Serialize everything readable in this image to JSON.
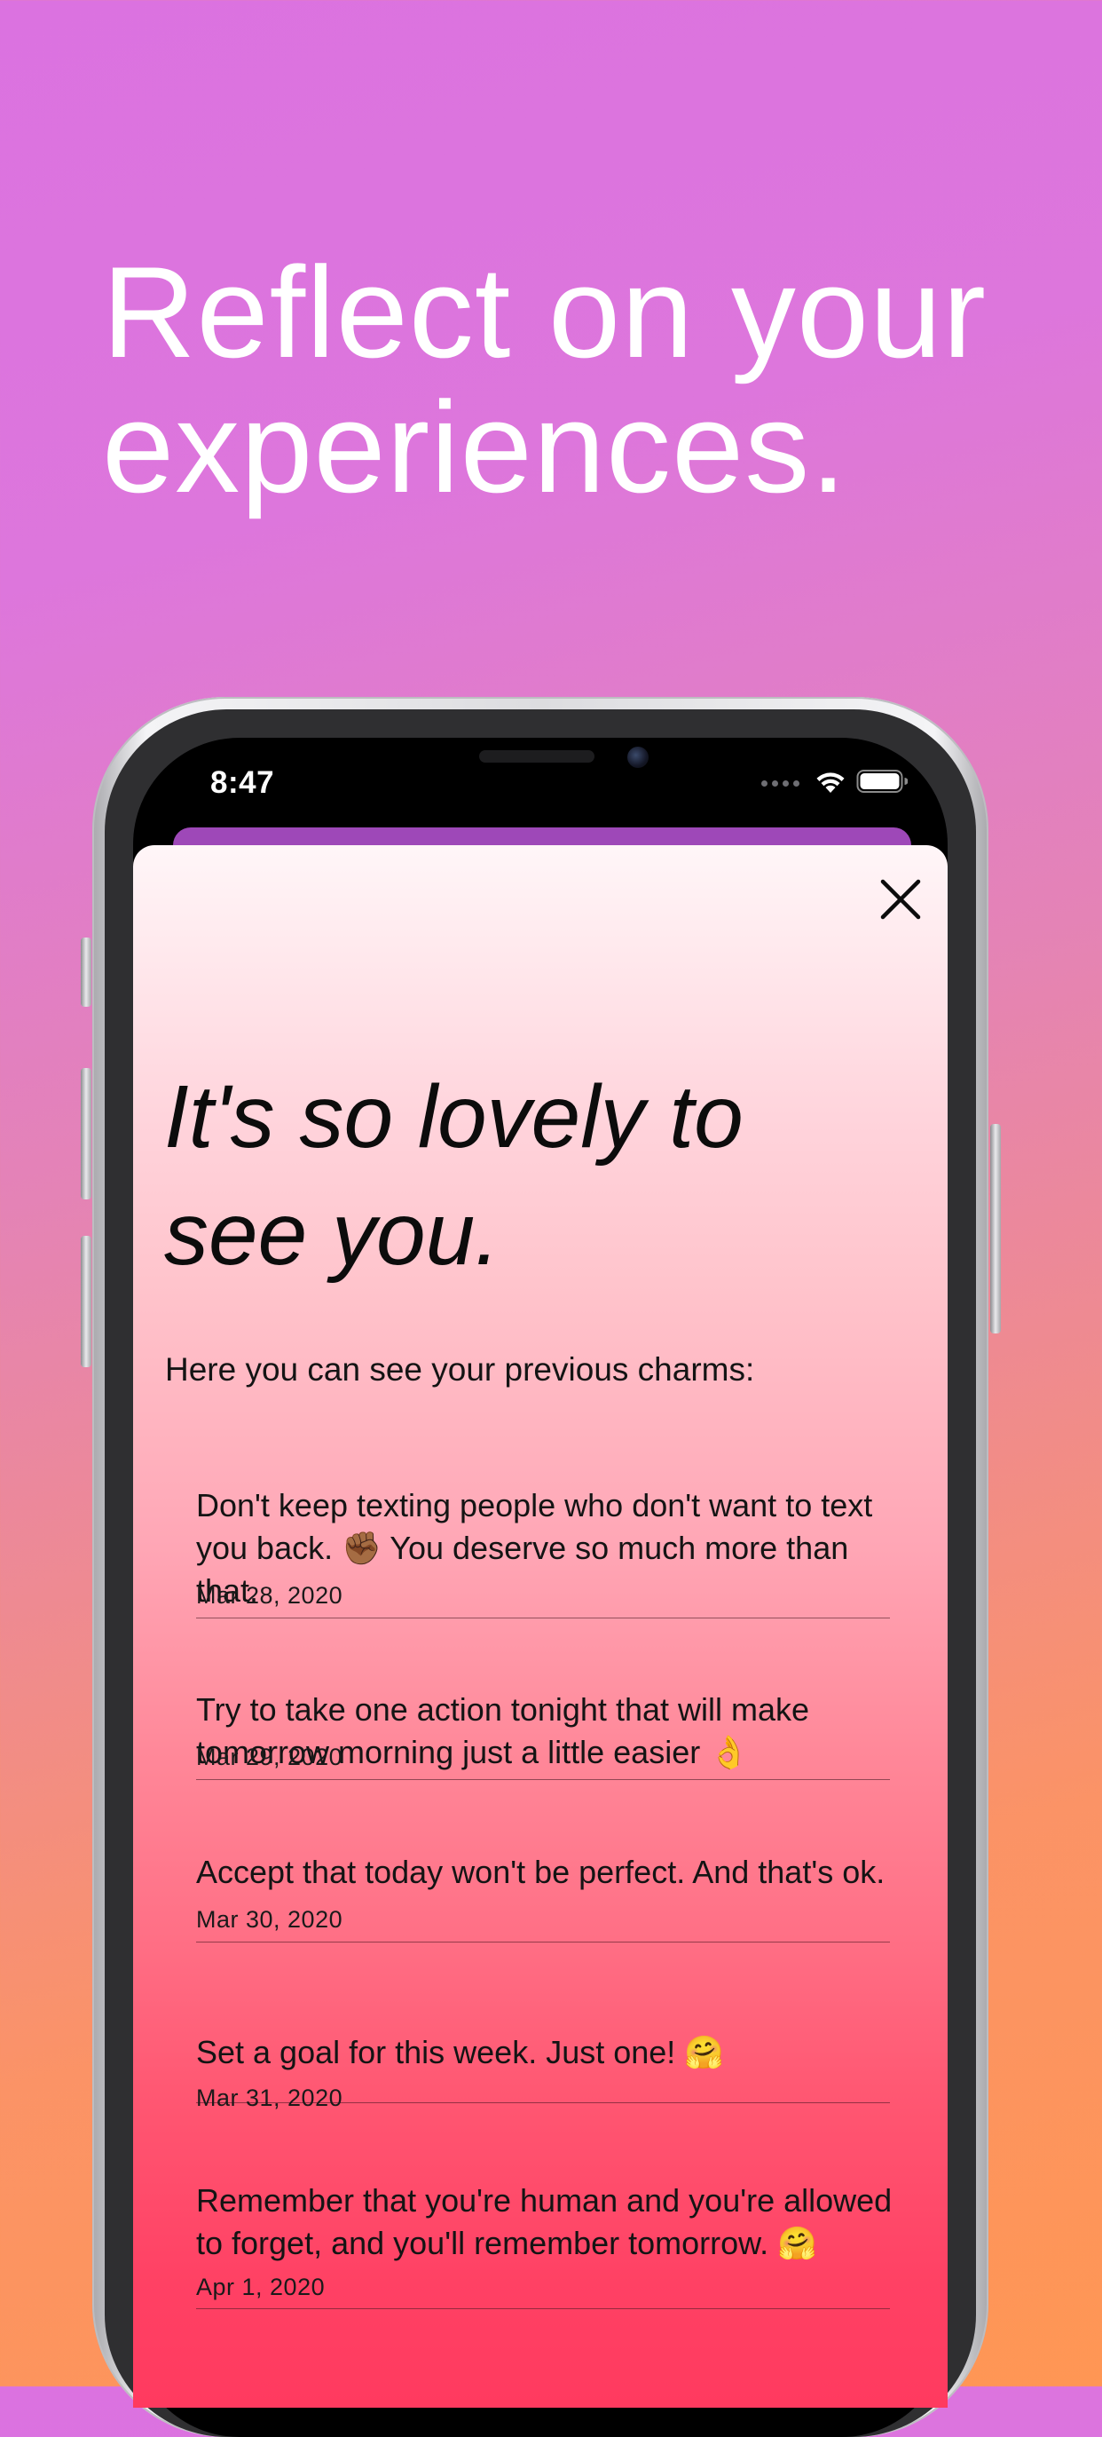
{
  "headline": {
    "line1": "Reflect on your",
    "line2": "experiences."
  },
  "status_bar": {
    "time": "8:47",
    "wifi_icon": "wifi-icon",
    "battery_icon": "battery-icon"
  },
  "modal": {
    "close_icon": "close-icon",
    "greeting_line1": "It's so lovely to",
    "greeting_line2": "see you.",
    "intro": "Here you can see your previous charms:",
    "charms": [
      {
        "text": "Don't keep texting people who don't want to text you back. ✊🏾 You deserve so much more than that.",
        "date": "Mar 28, 2020"
      },
      {
        "text": "Try to take one action tonight that will make tomorrow morning just a little easier 👌",
        "date": "Mar 29, 2020"
      },
      {
        "text": "Accept that today won't be perfect. And that's ok.",
        "date": "Mar 30, 2020"
      },
      {
        "text": "Set a goal for this week. Just one! 🤗",
        "date": "Mar 31, 2020"
      },
      {
        "text": "Remember that you're human and you're allowed to forget, and you'll remember tomorrow. 🤗",
        "date": "Apr 1, 2020"
      }
    ]
  },
  "colors": {
    "background_top": "#db72e0",
    "background_bottom": "#ff9654",
    "back_sheet": "#9e48b8",
    "card_top": "#fff6f8",
    "card_bottom": "#ff3a5f"
  }
}
